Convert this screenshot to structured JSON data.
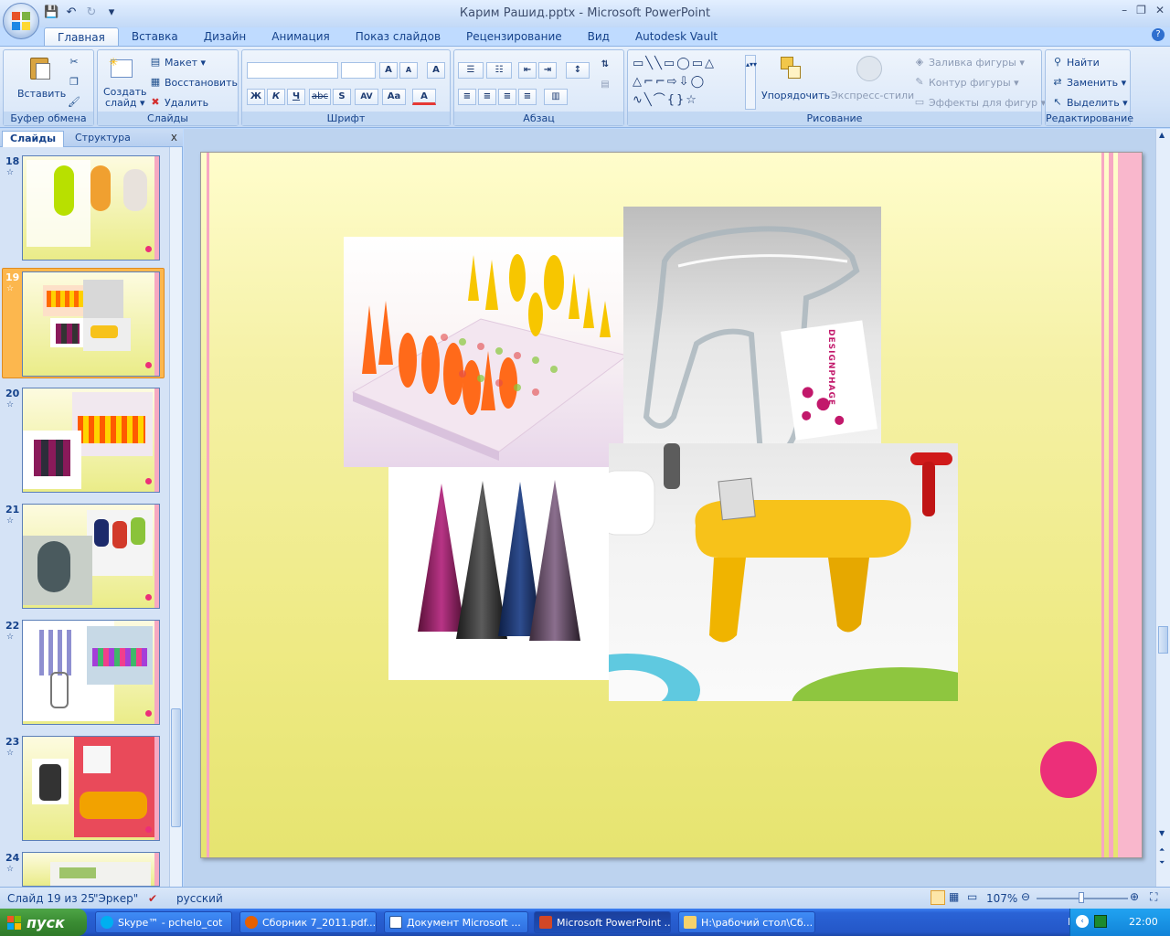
{
  "window": {
    "title": "Карим Рашид.pptx - Microsoft PowerPoint",
    "controls": [
      "–",
      "❐",
      "✕"
    ]
  },
  "qat": {
    "save": "💾",
    "undo": "↶",
    "redo": "↻",
    "customize": "▾"
  },
  "tabs": [
    "Главная",
    "Вставка",
    "Дизайн",
    "Анимация",
    "Показ слайдов",
    "Рецензирование",
    "Вид",
    "Autodesk Vault"
  ],
  "active_tab": "Главная",
  "help": "?",
  "ribbon": {
    "clipboard": {
      "label": "Буфер обмена",
      "paste": "Вставить"
    },
    "slides": {
      "label": "Слайды",
      "new_slide": "Создать слайд ▾",
      "new_slide_1": "Создать",
      "new_slide_2": "слайд ▾",
      "layout": "Макет ▾",
      "reset": "Восстановить",
      "delete": "Удалить"
    },
    "font": {
      "label": "Шрифт",
      "grow": "A",
      "shrink": "A",
      "clear": "A",
      "bold": "Ж",
      "italic": "К",
      "underline": "Ч",
      "strike": "abc",
      "shadow": "S",
      "spacing": "AV",
      "case": "Aa",
      "color": "A"
    },
    "paragraph": {
      "label": "Абзац"
    },
    "drawing": {
      "label": "Рисование",
      "arrange": "Упорядочить",
      "quick_styles": "Экспресс-стили",
      "fill": "Заливка фигуры ▾",
      "outline": "Контур фигуры ▾",
      "effects": "Эффекты для фигур ▾"
    },
    "editing": {
      "label": "Редактирование",
      "find": "Найти",
      "replace": "Заменить ▾",
      "select": "Выделить ▾"
    }
  },
  "panel": {
    "tab_slides": "Слайды",
    "tab_outline": "Структура",
    "close": "x",
    "thumbnails": [
      {
        "num": "18"
      },
      {
        "num": "19"
      },
      {
        "num": "20"
      },
      {
        "num": "21"
      },
      {
        "num": "22"
      },
      {
        "num": "23"
      },
      {
        "num": "24"
      }
    ],
    "selected": "19"
  },
  "slide": {
    "book_text": "DESIGNPHAGE"
  },
  "status": {
    "slide_info": "Слайд 19 из 25",
    "theme": "\"Эркер\"",
    "language": "русский",
    "zoom": "107%"
  },
  "taskbar": {
    "start": "пуск",
    "tasks": [
      "Skype™ - pchelo_cot",
      "Сборник 7_2011.pdf...",
      "Документ Microsoft ...",
      "Microsoft PowerPoint ...",
      "H:\\рабочий стол\\Сб..."
    ],
    "lang": "EN",
    "time": "22:00"
  },
  "colors": {
    "accent_pink": "#ec2f79",
    "stripe_pink": "#f7a7c3",
    "selected_thumb": "#fcb74e"
  }
}
